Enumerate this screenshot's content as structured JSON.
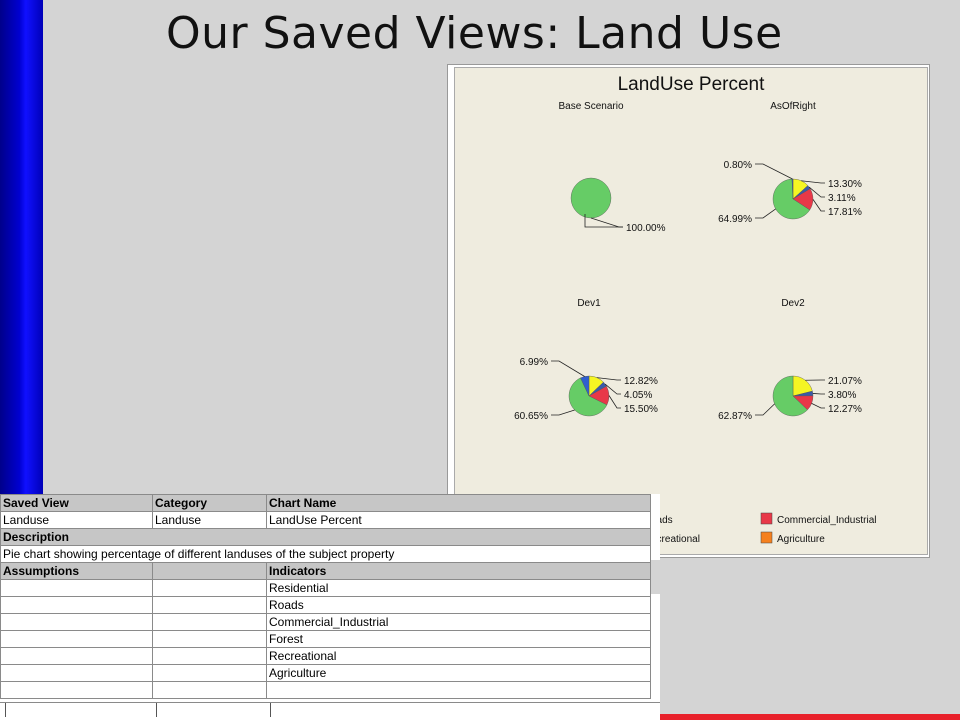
{
  "slide": {
    "title": "Our Saved Views: Land Use",
    "colors": {
      "left_bar": "#0000c8",
      "accent_line": "#e8202a",
      "background": "#d4d4d4"
    }
  },
  "chart_data": {
    "type": "pie",
    "title": "LandUse Percent",
    "colors": {
      "Residential": "#f5f523",
      "Roads": "#3a5aa8",
      "Commercial_Industrial": "#e83848",
      "Forest": "#66cc66",
      "Recreational": "#2f5fcf",
      "Agriculture": "#f5801e"
    },
    "pies": [
      {
        "name": "Base Scenario",
        "slices": [
          {
            "category": "Forest",
            "value": 100.0,
            "label": "100.00%"
          }
        ]
      },
      {
        "name": "AsOfRight",
        "slices": [
          {
            "category": "Residential",
            "value": 13.3,
            "label": "13.30%"
          },
          {
            "category": "Roads",
            "value": 3.11,
            "label": "3.11%"
          },
          {
            "category": "Commercial_Industrial",
            "value": 17.81,
            "label": "17.81%"
          },
          {
            "category": "Forest",
            "value": 64.99,
            "label": "64.99%"
          },
          {
            "category": "Recreational",
            "value": 0.8,
            "label": "0.80%"
          }
        ]
      },
      {
        "name": "Dev1",
        "slices": [
          {
            "category": "Residential",
            "value": 12.82,
            "label": "12.82%"
          },
          {
            "category": "Roads",
            "value": 4.05,
            "label": "4.05%"
          },
          {
            "category": "Commercial_Industrial",
            "value": 15.5,
            "label": "15.50%"
          },
          {
            "category": "Forest",
            "value": 60.65,
            "label": "60.65%"
          },
          {
            "category": "Recreational",
            "value": 6.99,
            "label": "6.99%"
          }
        ]
      },
      {
        "name": "Dev2",
        "slices": [
          {
            "category": "Residential",
            "value": 21.07,
            "label": "21.07%"
          },
          {
            "category": "Roads",
            "value": 3.8,
            "label": "3.80%"
          },
          {
            "category": "Commercial_Industrial",
            "value": 12.27,
            "label": "12.27%"
          },
          {
            "category": "Forest",
            "value": 62.87,
            "label": "62.87%"
          }
        ]
      }
    ],
    "legend": {
      "placement": "bottom",
      "entries": [
        "oads",
        "Commercial_Industrial",
        "ecreational",
        "Agriculture"
      ]
    }
  },
  "sheet": {
    "headers1": [
      "Saved View",
      "Category",
      "Chart Name"
    ],
    "row1": [
      "Landuse",
      "Landuse",
      "LandUse Percent"
    ],
    "description_header": "Description",
    "description": "Pie chart showing percentage of different landuses of the subject property",
    "assumptions_header": "Assumptions",
    "indicators_header": "Indicators",
    "indicators": [
      "Residential",
      "Roads",
      "Commercial_Industrial",
      "Forest",
      "Recreational",
      "Agriculture"
    ]
  }
}
